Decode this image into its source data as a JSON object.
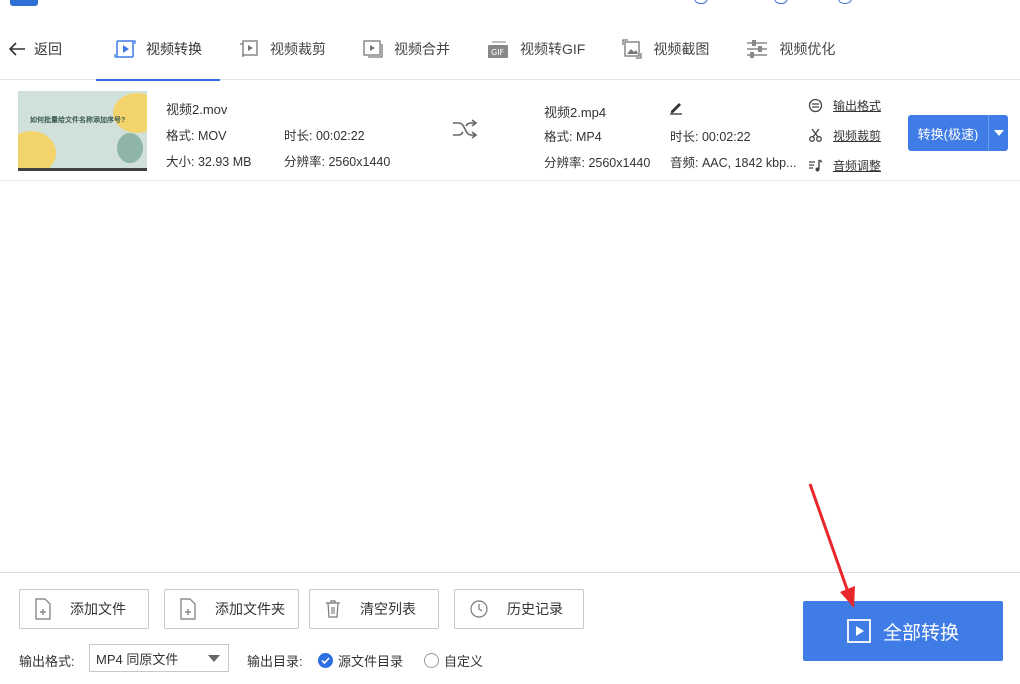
{
  "nav": {
    "back_label": "返回",
    "tabs": [
      {
        "label": "视频转换",
        "icon": "video-convert-icon"
      },
      {
        "label": "视频裁剪",
        "icon": "video-crop-icon"
      },
      {
        "label": "视频合并",
        "icon": "video-merge-icon"
      },
      {
        "label": "视频转GIF",
        "icon": "gif-icon"
      },
      {
        "label": "视频截图",
        "icon": "screenshot-icon"
      },
      {
        "label": "视频优化",
        "icon": "sliders-icon"
      }
    ],
    "active_tab": "视频转换"
  },
  "file": {
    "thumbnail_title": "如何批量给文件名称添加序号?",
    "source": {
      "name": "视频2.mov",
      "format": "格式: MOV",
      "duration": "时长: 00:02:22",
      "size": "大小: 32.93 MB",
      "resolution": "分辨率: 2560x1440"
    },
    "output": {
      "name": "视频2.mp4",
      "format": "格式: MP4",
      "duration": "时长: 00:02:22",
      "resolution": "分辨率: 2560x1440",
      "audio": "音频: AAC, 1842 kbp..."
    },
    "links": {
      "output_format": "输出格式",
      "video_crop": "视频裁剪",
      "audio_adjust": "音频调整"
    },
    "convert_button": "转换(极速)"
  },
  "bottom": {
    "add_file": "添加文件",
    "add_folder": "添加文件夹",
    "clear_list": "清空列表",
    "history": "历史记录",
    "output_format_label": "输出格式:",
    "output_format_value": "MP4 同原文件",
    "output_dir_label": "输出目录:",
    "dir_option_source": "源文件目录",
    "dir_option_custom": "自定义",
    "dir_selected": "源文件目录",
    "convert_all": "全部转换"
  },
  "colors": {
    "accent": "#3f7ce6",
    "annotation_arrow": "#e8262b"
  }
}
